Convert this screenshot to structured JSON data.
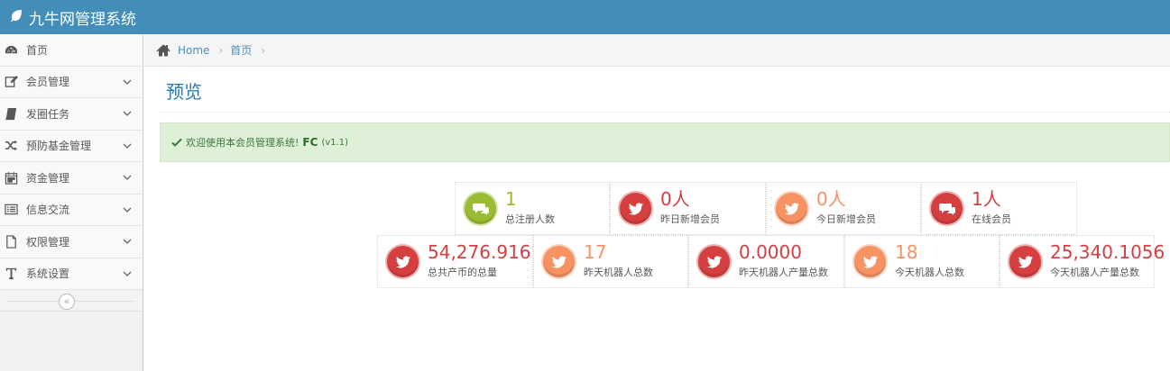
{
  "app": {
    "title": "九牛网管理系统",
    "icon": "leaf-icon"
  },
  "sidebar": {
    "items": [
      {
        "label": "首页",
        "icon": "dashboard-icon",
        "has_children": false
      },
      {
        "label": "会员管理",
        "icon": "edit-icon",
        "has_children": true
      },
      {
        "label": "发圈任务",
        "icon": "book-icon",
        "has_children": true
      },
      {
        "label": "预防基金管理",
        "icon": "shuffle-icon",
        "has_children": true
      },
      {
        "label": "资金管理",
        "icon": "calendar-icon",
        "has_children": true
      },
      {
        "label": "信息交流",
        "icon": "list-icon",
        "has_children": true
      },
      {
        "label": "权限管理",
        "icon": "file-icon",
        "has_children": true
      },
      {
        "label": "系统设置",
        "icon": "text-icon",
        "has_children": true
      }
    ],
    "collapse_glyph": "«"
  },
  "breadcrumbs": {
    "home": "Home",
    "current": "首页",
    "separator": "›"
  },
  "page": {
    "title": "预览"
  },
  "alert": {
    "text": "欢迎使用本会员管理系统!",
    "strong": "FC",
    "version": "(v1.1)"
  },
  "colors": {
    "green": "#9abc32",
    "red": "#d53f40",
    "orange": "#e8b110",
    "peach": "#f79263",
    "navbar": "#438eb9"
  },
  "stats_row1": [
    {
      "value": "1",
      "label": "总注册人数",
      "icon": "comments-icon",
      "color": "#9abc32"
    },
    {
      "value": "0人",
      "label": "昨日新增会员",
      "icon": "twitter-icon",
      "color": "#d53f40"
    },
    {
      "value": "0人",
      "label": "今日新增会员",
      "icon": "twitter-icon",
      "color": "#f79263"
    },
    {
      "value": "1人",
      "label": "在线会员",
      "icon": "comments-icon",
      "color": "#d53f40"
    }
  ],
  "stats_row2": [
    {
      "value": "54,276.9161",
      "label": "总共产币的总量",
      "icon": "twitter-icon",
      "color": "#d53f40"
    },
    {
      "value": "17",
      "label": "昨天机器人总数",
      "icon": "twitter-icon",
      "color": "#f79263"
    },
    {
      "value": "0.0000",
      "label": "昨天机器人产量总数",
      "icon": "twitter-icon",
      "color": "#d53f40"
    },
    {
      "value": "18",
      "label": "今天机器人总数",
      "icon": "twitter-icon",
      "color": "#f79263"
    },
    {
      "value": "25,340.1056",
      "label": "今天机器人产量总数",
      "icon": "twitter-icon",
      "color": "#d53f40"
    }
  ]
}
